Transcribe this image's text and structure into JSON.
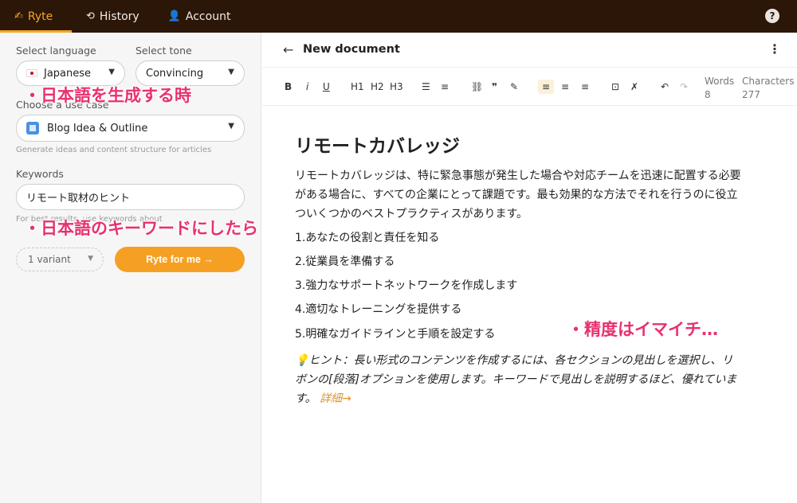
{
  "nav": {
    "brand": "Ryte",
    "history": "History",
    "account": "Account",
    "help": "?"
  },
  "sidebar": {
    "language_label": "Select language",
    "language_value": "Japanese",
    "tone_label": "Select tone",
    "tone_value": "Convincing",
    "usecase_label": "Choose a use case",
    "usecase_value": "Blog Idea & Outline",
    "usecase_hint": "Generate ideas and content structure for articles",
    "keywords_label": "Keywords",
    "keywords_value": "リモート取材のヒント",
    "keywords_hint": "For best results, use keywords about",
    "variant_value": "1 variant",
    "ryte_button": "Ryte for me →"
  },
  "annotations": {
    "a1": "・日本語を生成する時",
    "a2": "・日本語のキーワードにしたら",
    "a3": "・精度はイマイチ…"
  },
  "document": {
    "title": "New document",
    "words_label": "Words",
    "words_value": "8",
    "chars_label": "Characters",
    "chars_value": "277",
    "heading": "リモートカバレッジ",
    "intro": [
      "リモートカバレッジは、特に緊急事態が発生した場合や対応チームを迅速に配置する必要",
      "がある場合に、すべての企業にとって課題です。最も効果的な方法でそれを行うのに役立",
      "ついくつかのベストプラクティスがあります。"
    ],
    "items": [
      "1.あなたの役割と責任を知る",
      "2.従業員を準備する",
      "3.強力なサポートネットワークを作成します",
      "4.適切なトレーニングを提供する",
      "5.明確なガイドラインと手順を設定する"
    ],
    "tip_lines": [
      "💡ヒント：長い形式のコンテンツを作成するには、各セクションの見出しを選択し、リ",
      "ボンの[段落]オプションを使用します。キーワードで見出しを説明するほど、優れていま",
      "す。"
    ],
    "tip_link": "詳細→"
  },
  "toolbar": {
    "bold": "B",
    "italic": "i",
    "underline": "U",
    "h1": "H1",
    "h2": "H2",
    "h3": "H3"
  },
  "colors": {
    "nav_bg": "#2c1608",
    "accent": "#f5a623",
    "annotation": "#e8316f"
  }
}
